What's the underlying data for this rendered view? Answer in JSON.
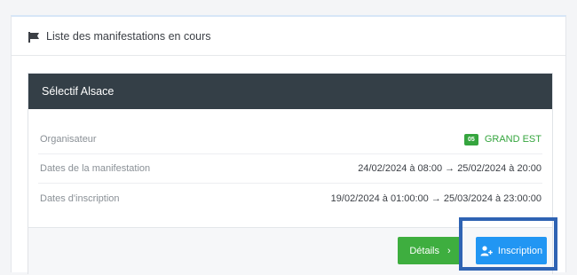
{
  "panel": {
    "icon": "flag-icon",
    "title": "Liste des manifestations en cours"
  },
  "event": {
    "name": "Sélectif Alsace",
    "rows": [
      {
        "label": "Organisateur",
        "badge": "05",
        "value": "GRAND EST"
      },
      {
        "label": "Dates de la manifestation",
        "value": "24/02/2024 à 08:00 → 25/02/2024 à 20:00"
      },
      {
        "label": "Dates d'inscription",
        "value": "19/02/2024 à 01:00:00 → 25/03/2024 à 23:00:00"
      }
    ],
    "details_button": "Détails",
    "details_icon": "chevron-right-icon",
    "details_chevron": "›",
    "inscription_button": "Inscription",
    "inscription_icon": "user-add-icon"
  },
  "colors": {
    "card_header": "#343f47",
    "green": "#3eae3f",
    "blue": "#2196f3",
    "highlight": "#2f63b3"
  }
}
